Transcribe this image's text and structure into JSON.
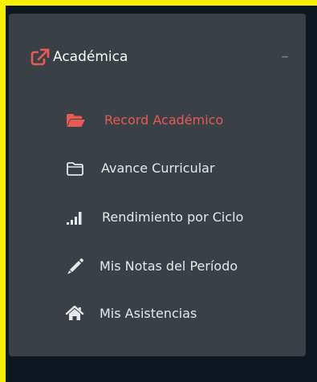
{
  "sidebar": {
    "section": {
      "title": "Académica",
      "icon": "external-link-icon",
      "collapse_symbol": "–"
    },
    "items": [
      {
        "label": "Record Académico",
        "icon": "folder-open-icon",
        "active": true
      },
      {
        "label": "Avance Curricular",
        "icon": "folder-outline-icon",
        "active": false
      },
      {
        "label": "Rendimiento por Ciclo",
        "icon": "signal-bars-icon",
        "active": false
      },
      {
        "label": "Mis Notas del Período",
        "icon": "pencil-icon",
        "active": false
      },
      {
        "label": "Mis Asistencias",
        "icon": "home-icon",
        "active": false
      }
    ]
  },
  "colors": {
    "page_border": "#f7f000",
    "background": "#0d1722",
    "panel": "#394046",
    "accent": "#ea5a55",
    "text": "#e6e8ea",
    "muted": "#8a9096"
  }
}
